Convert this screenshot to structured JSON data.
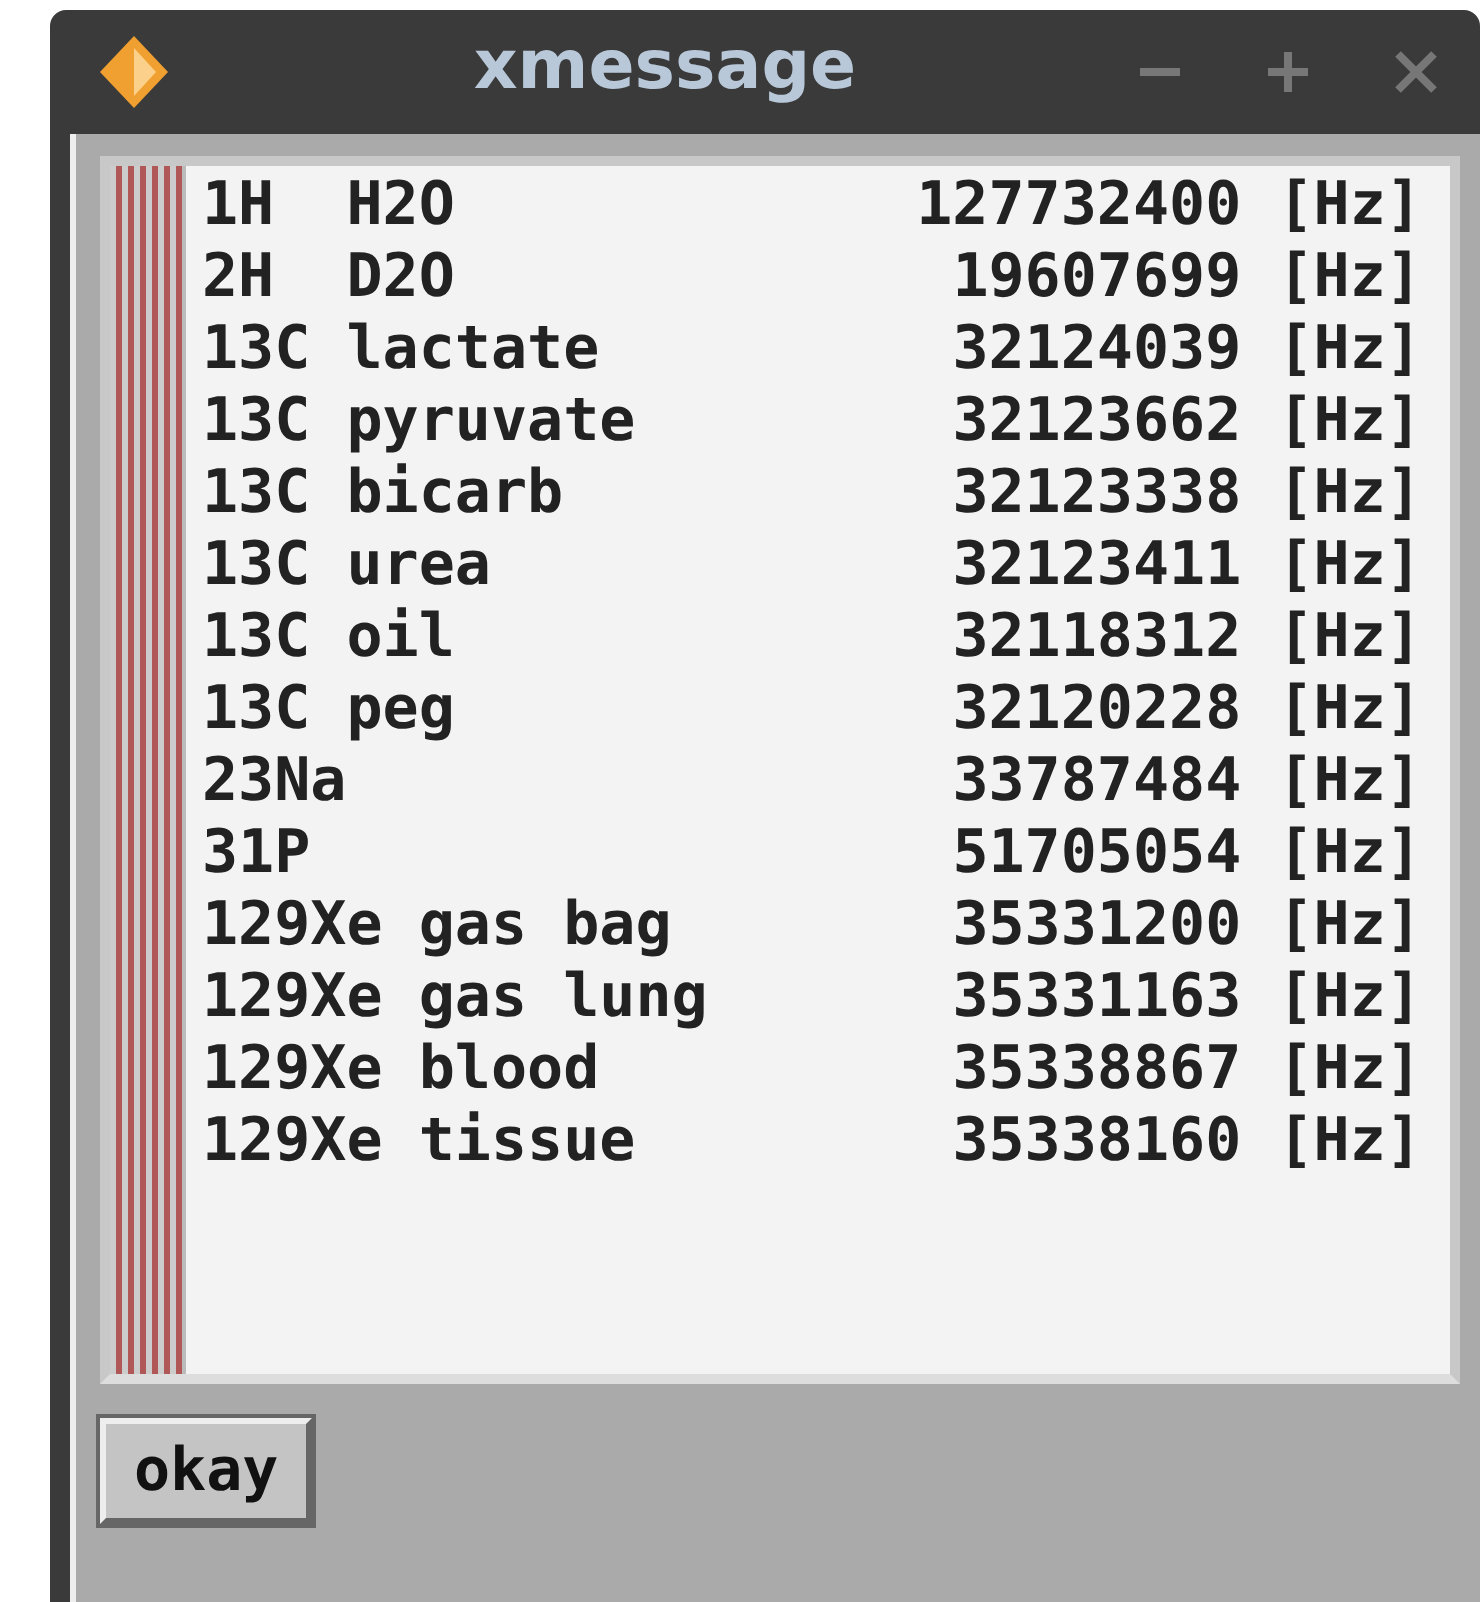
{
  "window": {
    "title": "xmessage"
  },
  "lines": [
    {
      "label": "1H  H2O",
      "value": "127732400 [Hz]"
    },
    {
      "label": "2H  D2O",
      "value": "19607699 [Hz]"
    },
    {
      "label": "13C lactate",
      "value": "32124039 [Hz]"
    },
    {
      "label": "13C pyruvate",
      "value": "32123662 [Hz]"
    },
    {
      "label": "13C bicarb",
      "value": "32123338 [Hz]"
    },
    {
      "label": "13C urea",
      "value": "32123411 [Hz]"
    },
    {
      "label": "13C oil",
      "value": "32118312 [Hz]"
    },
    {
      "label": "13C peg",
      "value": "32120228 [Hz]"
    },
    {
      "label": "23Na",
      "value": "33787484 [Hz]"
    },
    {
      "label": "31P",
      "value": "51705054 [Hz]"
    },
    {
      "label": "129Xe gas bag",
      "value": "35331200 [Hz]"
    },
    {
      "label": "129Xe gas lung",
      "value": "35331163 [Hz]"
    },
    {
      "label": "129Xe blood",
      "value": "35338867 [Hz]"
    },
    {
      "label": "129Xe tissue",
      "value": "35338160 [Hz]"
    }
  ],
  "buttons": [
    "okay"
  ]
}
